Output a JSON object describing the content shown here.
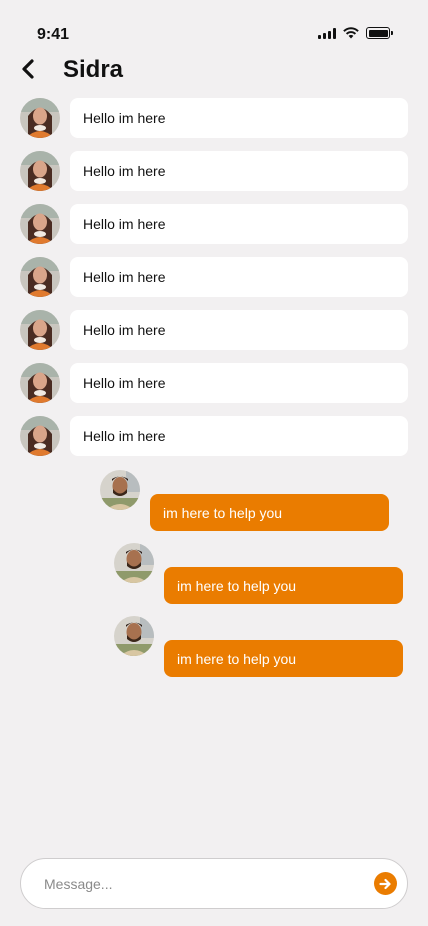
{
  "status_bar": {
    "time": "9:41"
  },
  "header": {
    "title": "Sidra"
  },
  "messages_in": [
    {
      "text": "Hello im here"
    },
    {
      "text": "Hello im here"
    },
    {
      "text": "Hello im here"
    },
    {
      "text": "Hello im here"
    },
    {
      "text": "Hello im here"
    },
    {
      "text": "Hello im here"
    },
    {
      "text": "Hello im here"
    }
  ],
  "messages_out": [
    {
      "text": "im here to help you"
    },
    {
      "text": "im here to help you"
    },
    {
      "text": "im here to help you"
    }
  ],
  "composer": {
    "placeholder": "Message..."
  },
  "colors": {
    "accent": "#ea7c00",
    "background": "#f2f0f1",
    "bubble_in": "#ffffff"
  },
  "icons": {
    "back": "chevron-left-icon",
    "send": "arrow-right-icon",
    "signal": "signal-icon",
    "wifi": "wifi-icon",
    "battery": "battery-icon"
  }
}
